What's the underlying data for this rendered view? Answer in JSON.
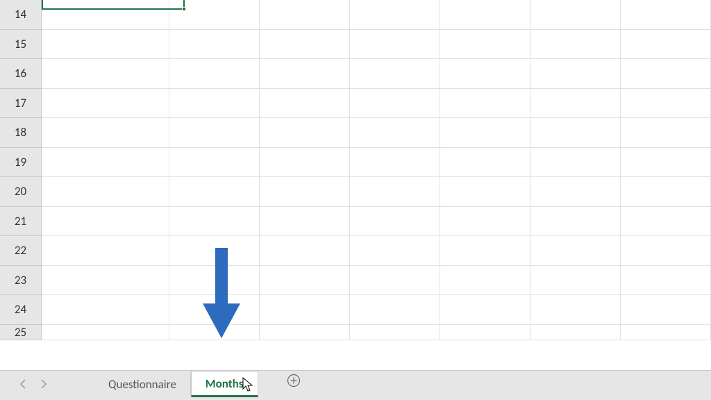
{
  "rows": [
    "14",
    "15",
    "16",
    "17",
    "18",
    "19",
    "20",
    "21",
    "22",
    "23",
    "24",
    "25"
  ],
  "tabs": {
    "questionnaire": "Questionnaire",
    "months": "Months"
  },
  "arrow_color": "#2c6bbd",
  "selection_color": "#217346"
}
